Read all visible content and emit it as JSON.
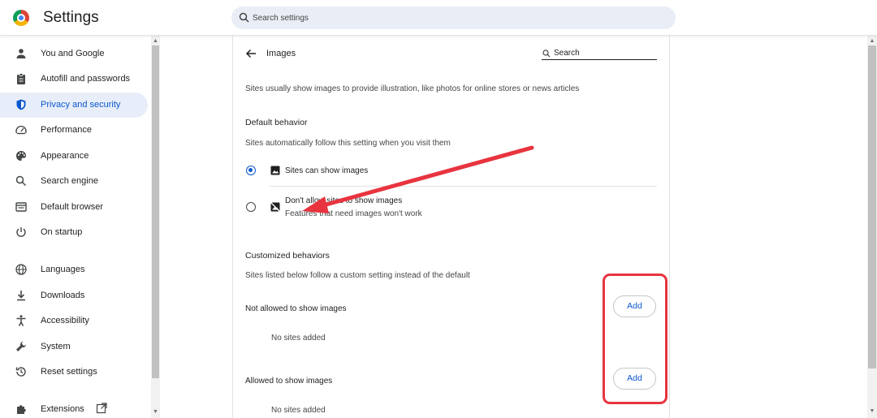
{
  "header": {
    "app_title": "Settings",
    "search_placeholder": "Search settings"
  },
  "sidebar": {
    "items": [
      {
        "label": "You and Google",
        "icon": "person-icon"
      },
      {
        "label": "Autofill and passwords",
        "icon": "clipboard-icon"
      },
      {
        "label": "Privacy and security",
        "icon": "shield-icon",
        "active": true
      },
      {
        "label": "Performance",
        "icon": "gauge-icon"
      },
      {
        "label": "Appearance",
        "icon": "palette-icon"
      },
      {
        "label": "Search engine",
        "icon": "search-icon"
      },
      {
        "label": "Default browser",
        "icon": "browser-icon"
      },
      {
        "label": "On startup",
        "icon": "power-icon"
      },
      {
        "label": "Languages",
        "icon": "globe-icon"
      },
      {
        "label": "Downloads",
        "icon": "download-icon"
      },
      {
        "label": "Accessibility",
        "icon": "accessibility-icon"
      },
      {
        "label": "System",
        "icon": "wrench-icon"
      },
      {
        "label": "Reset settings",
        "icon": "history-icon"
      },
      {
        "label": "Extensions",
        "icon": "puzzle-icon"
      }
    ]
  },
  "main": {
    "page_title": "Images",
    "search_placeholder": "Search",
    "description": "Sites usually show images to provide illustration, like photos for online stores or news articles",
    "default_behavior": {
      "heading": "Default behavior",
      "subtext": "Sites automatically follow this setting when you visit them",
      "options": [
        {
          "label": "Sites can show images",
          "selected": true
        },
        {
          "label": "Don't allow sites to show images",
          "sublabel": "Features that need images won't work",
          "selected": false
        }
      ]
    },
    "customized": {
      "heading": "Customized behaviors",
      "subtext": "Sites listed below follow a custom setting instead of the default",
      "not_allowed_label": "Not allowed to show images",
      "allowed_label": "Allowed to show images",
      "add_label": "Add",
      "empty_label": "No sites added"
    }
  },
  "colors": {
    "accent": "#0b57d0",
    "annotation": "#e8343f"
  }
}
